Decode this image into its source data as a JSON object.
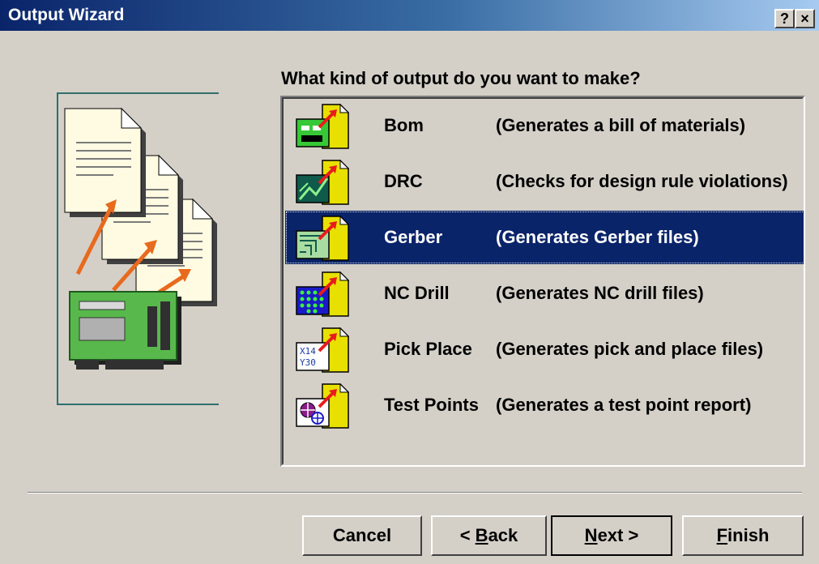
{
  "window": {
    "title": "Output Wizard",
    "help_glyph": "?",
    "close_glyph": "×"
  },
  "prompt": "What kind of output do you want to make?",
  "outputs": [
    {
      "name": "Bom",
      "description": "(Generates a bill of materials)",
      "icon": "bom-icon"
    },
    {
      "name": "DRC",
      "description": "(Checks for design rule violations)",
      "icon": "drc-icon"
    },
    {
      "name": "Gerber",
      "description": "(Generates Gerber files)",
      "icon": "gerber-icon",
      "selected": true
    },
    {
      "name": "NC Drill",
      "description": "(Generates NC drill files)",
      "icon": "nc-drill-icon"
    },
    {
      "name": "Pick Place",
      "description": "(Generates pick and place files)",
      "icon": "pick-place-icon"
    },
    {
      "name": "Test Points",
      "description": "(Generates a test point report)",
      "icon": "test-points-icon"
    }
  ],
  "buttons": {
    "cancel": "Cancel",
    "back_prefix": "< ",
    "back_mnemonic": "B",
    "back_rest": "ack",
    "next_mnemonic": "N",
    "next_rest": "ext >",
    "finish_mnemonic": "F",
    "finish_rest": "inish"
  },
  "colors": {
    "face": "#d4d0c8",
    "selection": "#0a246a",
    "title_gradient_start": "#0a246a",
    "title_gradient_end": "#a6caf0"
  }
}
